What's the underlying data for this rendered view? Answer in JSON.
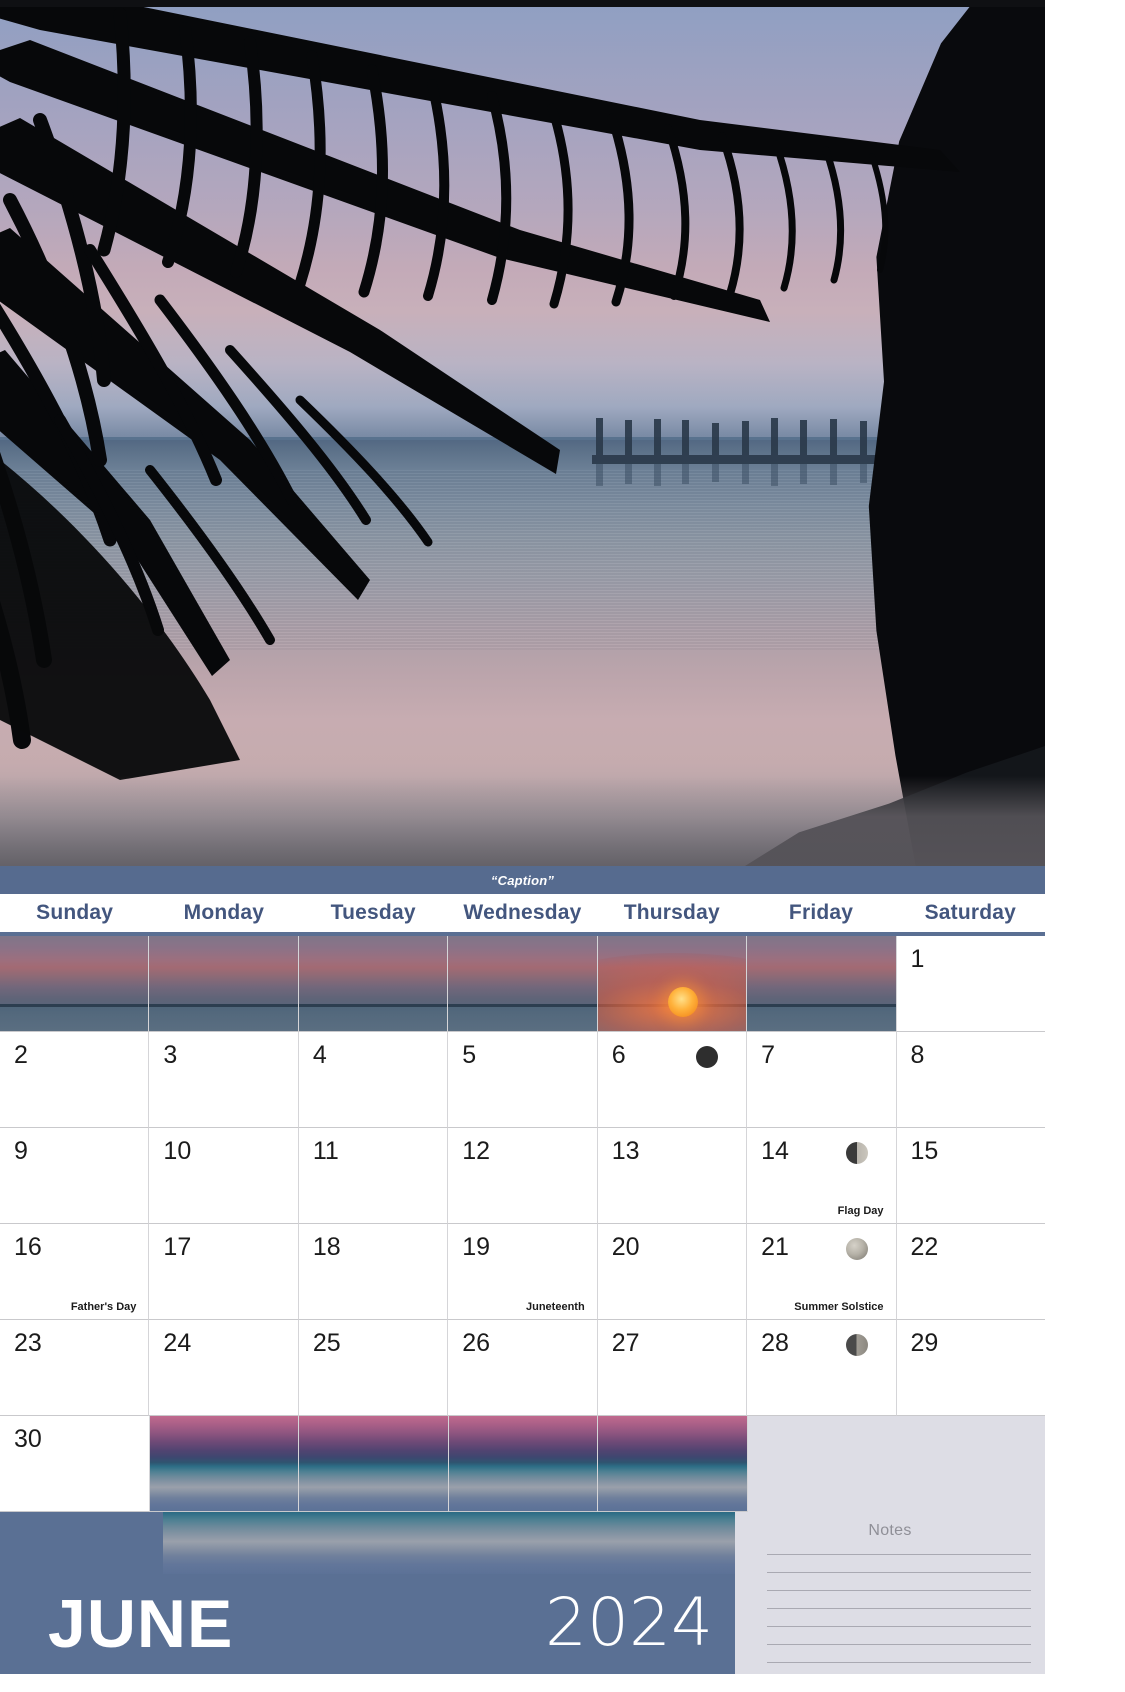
{
  "hero": {
    "alt": "palm-frond-silhouette-over-ocean-pier-at-dusk"
  },
  "caption": {
    "text": "“Caption”"
  },
  "weekday_headers": [
    "Sunday",
    "Monday",
    "Tuesday",
    "Wednesday",
    "Thursday",
    "Friday",
    "Saturday"
  ],
  "month": {
    "name": "JUNE",
    "year": "2024"
  },
  "notes": {
    "title": "Notes",
    "line_count": 7
  },
  "moon_phase_names": {
    "new": "new-moon",
    "first_quarter": "first-quarter-moon",
    "full": "full-moon",
    "last_quarter": "last-quarter-moon"
  },
  "weeks": [
    [
      {
        "day": "",
        "type": "photo"
      },
      {
        "day": "",
        "type": "photo"
      },
      {
        "day": "",
        "type": "photo"
      },
      {
        "day": "",
        "type": "photo"
      },
      {
        "day": "",
        "type": "photo"
      },
      {
        "day": "",
        "type": "photo"
      },
      {
        "day": "1",
        "type": "day",
        "holiday": "",
        "moon": ""
      }
    ],
    [
      {
        "day": "2",
        "type": "day",
        "holiday": "",
        "moon": ""
      },
      {
        "day": "3",
        "type": "day",
        "holiday": "",
        "moon": ""
      },
      {
        "day": "4",
        "type": "day",
        "holiday": "",
        "moon": ""
      },
      {
        "day": "5",
        "type": "day",
        "holiday": "",
        "moon": ""
      },
      {
        "day": "6",
        "type": "day",
        "holiday": "",
        "moon": "new"
      },
      {
        "day": "7",
        "type": "day",
        "holiday": "",
        "moon": ""
      },
      {
        "day": "8",
        "type": "day",
        "holiday": "",
        "moon": ""
      }
    ],
    [
      {
        "day": "9",
        "type": "day",
        "holiday": "",
        "moon": ""
      },
      {
        "day": "10",
        "type": "day",
        "holiday": "",
        "moon": ""
      },
      {
        "day": "11",
        "type": "day",
        "holiday": "",
        "moon": ""
      },
      {
        "day": "12",
        "type": "day",
        "holiday": "",
        "moon": ""
      },
      {
        "day": "13",
        "type": "day",
        "holiday": "",
        "moon": ""
      },
      {
        "day": "14",
        "type": "day",
        "holiday": "Flag Day",
        "moon": "first_quarter"
      },
      {
        "day": "15",
        "type": "day",
        "holiday": "",
        "moon": ""
      }
    ],
    [
      {
        "day": "16",
        "type": "day",
        "holiday": "Father's Day",
        "moon": ""
      },
      {
        "day": "17",
        "type": "day",
        "holiday": "",
        "moon": ""
      },
      {
        "day": "18",
        "type": "day",
        "holiday": "",
        "moon": ""
      },
      {
        "day": "19",
        "type": "day",
        "holiday": "Juneteenth",
        "moon": ""
      },
      {
        "day": "20",
        "type": "day",
        "holiday": "",
        "moon": ""
      },
      {
        "day": "21",
        "type": "day",
        "holiday": "Summer Solstice",
        "moon": "full"
      },
      {
        "day": "22",
        "type": "day",
        "holiday": "",
        "moon": ""
      }
    ],
    [
      {
        "day": "23",
        "type": "day",
        "holiday": "",
        "moon": ""
      },
      {
        "day": "24",
        "type": "day",
        "holiday": "",
        "moon": ""
      },
      {
        "day": "25",
        "type": "day",
        "holiday": "",
        "moon": ""
      },
      {
        "day": "26",
        "type": "day",
        "holiday": "",
        "moon": ""
      },
      {
        "day": "27",
        "type": "day",
        "holiday": "",
        "moon": ""
      },
      {
        "day": "28",
        "type": "day",
        "holiday": "",
        "moon": "last_quarter"
      },
      {
        "day": "29",
        "type": "day",
        "holiday": "",
        "moon": ""
      }
    ],
    [
      {
        "day": "30",
        "type": "day",
        "holiday": "",
        "moon": ""
      },
      {
        "day": "",
        "type": "photo"
      },
      {
        "day": "",
        "type": "photo"
      },
      {
        "day": "",
        "type": "photo"
      },
      {
        "day": "",
        "type": "photo"
      },
      {
        "day": "",
        "type": "notes"
      },
      {
        "day": "",
        "type": "notes"
      }
    ]
  ],
  "colors": {
    "accent": "#5a7094",
    "caption_bar": "#566b8f",
    "header_text": "#43567e",
    "notes_bg": "#dddde5",
    "grid_line": "#d5d5d8"
  }
}
